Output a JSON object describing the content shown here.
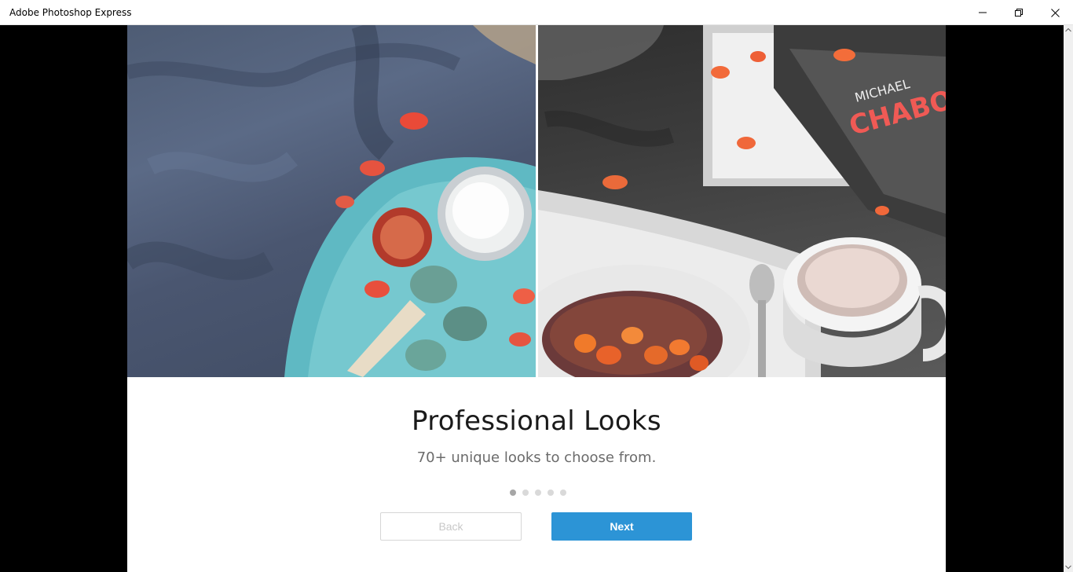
{
  "window": {
    "title": "Adobe Photoshop Express",
    "controls": {
      "minimize": "minimize-icon",
      "maximize": "restore-icon",
      "close": "close-icon"
    }
  },
  "onboarding": {
    "heading": "Professional Looks",
    "subheading": "70+ unique looks to choose from.",
    "pagination": {
      "total": 5,
      "current": 1
    },
    "buttons": {
      "back_label": "Back",
      "next_label": "Next"
    }
  },
  "colors": {
    "accent": "#2c94d6",
    "titlebar_bg": "#ffffff",
    "page_bg": "#000000"
  }
}
